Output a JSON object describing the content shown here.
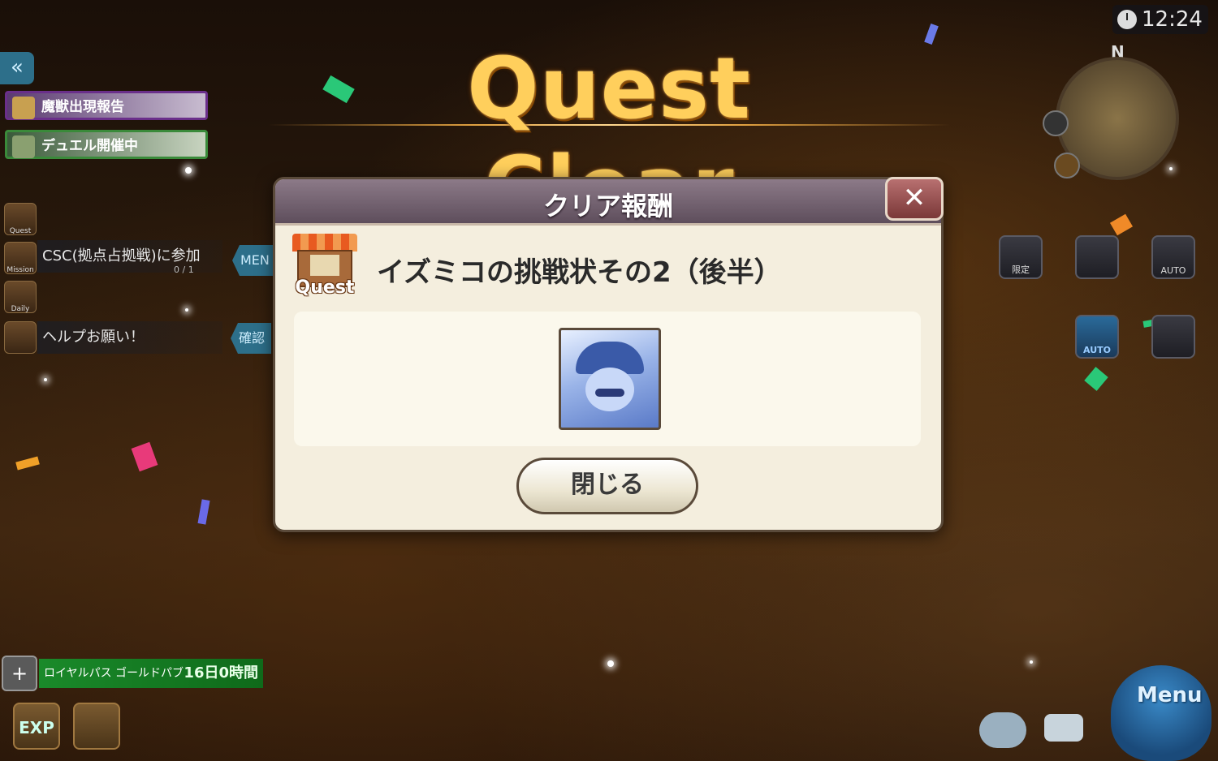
{
  "header": {
    "title": "Quest Clear"
  },
  "clock": {
    "time": "12:24"
  },
  "minimap": {
    "north": "N"
  },
  "sidebar": {
    "back_icon": "«",
    "notices": [
      {
        "label": "魔獣出現報告",
        "color": "#6a2f8a"
      },
      {
        "label": "デュエル開催中",
        "color": "#3a8a3a"
      }
    ],
    "icons": [
      {
        "label": "Quest"
      },
      {
        "label": "Mission"
      },
      {
        "label": "Daily"
      }
    ],
    "mission": {
      "text": "CSC(拠点占拠戦)に参加",
      "count": "0 / 1",
      "tag": "MEN"
    },
    "help": {
      "text": "ヘルプお願い！",
      "tag": "確認"
    }
  },
  "pass": {
    "label": "ロイヤルパス ゴールドパブ",
    "time": "16日0時間",
    "icon": "+"
  },
  "bottom": {
    "exp_label": "EXP"
  },
  "right_icons": {
    "limited": "限定",
    "auto": "AUTO",
    "auto2": "AUTO"
  },
  "menu": {
    "label": "Menu"
  },
  "modal": {
    "title": "クリア報酬",
    "close_icon": "✕",
    "quest_icon_label": "Quest",
    "quest_name": "イズミコの挑戦状その2（後半）",
    "close_button": "閉じる"
  }
}
